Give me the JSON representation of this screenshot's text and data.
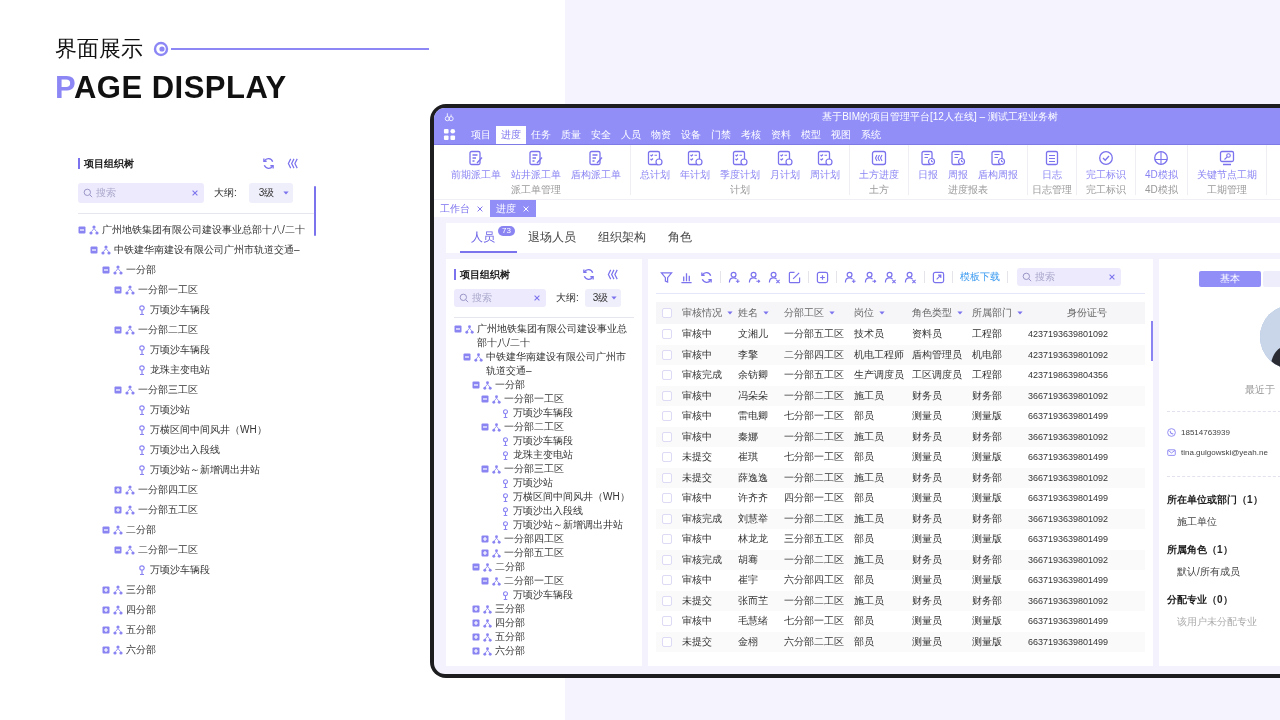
{
  "showcase": {
    "title": "界面展示",
    "subtitle": "PAGE DISPLAY",
    "tree_panel": {
      "title": "项目组织树",
      "search": {
        "placeholder": "搜索"
      },
      "outline_label": "大纲:",
      "outline_value": "3级",
      "tree": [
        {
          "label": "广州地铁集团有限公司建设事业总部十八/二十",
          "kind": "org",
          "expanded": true,
          "children": [
            {
              "label": "中铁建华南建设有限公司广州市轨道交通–",
              "kind": "org",
              "expanded": true,
              "children": [
                {
                  "label": "一分部",
                  "kind": "org",
                  "expanded": true,
                  "children": [
                    {
                      "label": "一分部一工区",
                      "kind": "org",
                      "expanded": true,
                      "children": [
                        {
                          "label": "万顷沙车辆段",
                          "kind": "site"
                        }
                      ]
                    },
                    {
                      "label": "一分部二工区",
                      "kind": "org",
                      "expanded": true,
                      "children": [
                        {
                          "label": "万顷沙车辆段",
                          "kind": "site"
                        },
                        {
                          "label": "龙珠主变电站",
                          "kind": "site"
                        }
                      ]
                    },
                    {
                      "label": "一分部三工区",
                      "kind": "org",
                      "expanded": true,
                      "children": [
                        {
                          "label": "万顷沙站",
                          "kind": "site"
                        },
                        {
                          "label": "万横区间中间风井（WH）",
                          "kind": "site"
                        },
                        {
                          "label": "万顷沙出入段线",
                          "kind": "site"
                        },
                        {
                          "label": "万顷沙站～新增调出井站",
                          "kind": "site"
                        }
                      ]
                    },
                    {
                      "label": "一分部四工区",
                      "kind": "org",
                      "expanded": false
                    },
                    {
                      "label": "一分部五工区",
                      "kind": "org",
                      "expanded": false
                    }
                  ]
                },
                {
                  "label": "二分部",
                  "kind": "org",
                  "expanded": true,
                  "children": [
                    {
                      "label": "二分部一工区",
                      "kind": "org",
                      "expanded": true,
                      "children": [
                        {
                          "label": "万顷沙车辆段",
                          "kind": "site"
                        }
                      ]
                    }
                  ]
                },
                {
                  "label": "三分部",
                  "kind": "org",
                  "expanded": false
                },
                {
                  "label": "四分部",
                  "kind": "org",
                  "expanded": false
                },
                {
                  "label": "五分部",
                  "kind": "org",
                  "expanded": false
                },
                {
                  "label": "六分部",
                  "kind": "org",
                  "expanded": false
                }
              ]
            }
          ]
        }
      ]
    }
  },
  "app": {
    "window": {
      "title": "基于BIM的项目管理平台[12人在线] – 测试工程业务树"
    },
    "menu": [
      {
        "label": "项目",
        "selected": false
      },
      {
        "label": "进度",
        "selected": true
      },
      {
        "label": "任务",
        "selected": false
      },
      {
        "label": "质量",
        "selected": false
      },
      {
        "label": "安全",
        "selected": false
      },
      {
        "label": "人员",
        "selected": false
      },
      {
        "label": "物资",
        "selected": false
      },
      {
        "label": "设备",
        "selected": false
      },
      {
        "label": "门禁",
        "selected": false
      },
      {
        "label": "考核",
        "selected": false
      },
      {
        "label": "资料",
        "selected": false
      },
      {
        "label": "模型",
        "selected": false
      },
      {
        "label": "视图",
        "selected": false
      },
      {
        "label": "系统",
        "selected": false
      }
    ],
    "ribbon": [
      {
        "label": "派工单管理",
        "items": [
          "前期派工单",
          "站井派工单",
          "盾构派工单"
        ]
      },
      {
        "label": "计划",
        "items": [
          "总计划",
          "年计划",
          "季度计划",
          "月计划",
          "周计划"
        ]
      },
      {
        "label": "土方",
        "items": [
          "土方进度"
        ]
      },
      {
        "label": "进度报表",
        "items": [
          "日报",
          "周报",
          "盾构周报"
        ]
      },
      {
        "label": "日志管理",
        "items": [
          "日志"
        ]
      },
      {
        "label": "完工标识",
        "items": [
          "完工标识"
        ]
      },
      {
        "label": "4D模拟",
        "items": [
          "4D模拟"
        ]
      },
      {
        "label": "工期管理",
        "items": [
          "关键节点工期"
        ]
      }
    ],
    "open_tabs": [
      {
        "label": "工作台",
        "selected": false
      },
      {
        "label": "进度",
        "selected": true
      }
    ],
    "people_tabs": [
      {
        "label": "人员",
        "badge": "73",
        "selected": true
      },
      {
        "label": "退场人员",
        "selected": false
      },
      {
        "label": "组织架构",
        "selected": false
      },
      {
        "label": "角色",
        "selected": false
      }
    ],
    "org_panel": {
      "title": "项目组织树",
      "search": {
        "placeholder": "搜索"
      },
      "outline_label": "大纲:",
      "outline_value": "3级",
      "tree": [
        {
          "label": "广州地铁集团有限公司建设事业总部十八/二十",
          "kind": "org",
          "expanded": true,
          "children": [
            {
              "label": "中铁建华南建设有限公司广州市轨道交通–",
              "kind": "org",
              "expanded": true,
              "children": [
                {
                  "label": "一分部",
                  "kind": "org",
                  "expanded": true,
                  "children": [
                    {
                      "label": "一分部一工区",
                      "kind": "org",
                      "expanded": true,
                      "children": [
                        {
                          "label": "万顷沙车辆段",
                          "kind": "site"
                        }
                      ]
                    },
                    {
                      "label": "一分部二工区",
                      "kind": "org",
                      "expanded": true,
                      "children": [
                        {
                          "label": "万顷沙车辆段",
                          "kind": "site"
                        },
                        {
                          "label": "龙珠主变电站",
                          "kind": "site"
                        }
                      ]
                    },
                    {
                      "label": "一分部三工区",
                      "kind": "org",
                      "expanded": true,
                      "children": [
                        {
                          "label": "万顷沙站",
                          "kind": "site"
                        },
                        {
                          "label": "万横区间中间风井（WH）",
                          "kind": "site"
                        },
                        {
                          "label": "万顷沙出入段线",
                          "kind": "site"
                        },
                        {
                          "label": "万顷沙站～新增调出井站",
                          "kind": "site"
                        }
                      ]
                    },
                    {
                      "label": "一分部四工区",
                      "kind": "org",
                      "expanded": false
                    },
                    {
                      "label": "一分部五工区",
                      "kind": "org",
                      "expanded": false
                    }
                  ]
                },
                {
                  "label": "二分部",
                  "kind": "org",
                  "expanded": true,
                  "children": [
                    {
                      "label": "二分部一工区",
                      "kind": "org",
                      "expanded": true,
                      "children": [
                        {
                          "label": "万顷沙车辆段",
                          "kind": "site"
                        }
                      ]
                    }
                  ]
                },
                {
                  "label": "三分部",
                  "kind": "org",
                  "expanded": false
                },
                {
                  "label": "四分部",
                  "kind": "org",
                  "expanded": false
                },
                {
                  "label": "五分部",
                  "kind": "org",
                  "expanded": false
                },
                {
                  "label": "六分部",
                  "kind": "org",
                  "expanded": false
                }
              ]
            }
          ]
        }
      ]
    },
    "toolbar": {
      "template_link": "模板下载",
      "search": {
        "placeholder": "搜索"
      }
    },
    "table": {
      "all_checked": false,
      "columns": [
        {
          "label": "审核情况",
          "sortable": true
        },
        {
          "label": "姓名",
          "sortable": true
        },
        {
          "label": "分部工区",
          "sortable": true
        },
        {
          "label": "岗位",
          "sortable": true
        },
        {
          "label": "角色类型",
          "sortable": true
        },
        {
          "label": "所属部门",
          "sortable": true
        },
        {
          "label": "身份证号",
          "sortable": false
        }
      ],
      "rows": [
        {
          "checked": false,
          "cells": [
            "审核中",
            "文湘儿",
            "一分部五工区",
            "技术员",
            "资料员",
            "工程部",
            "4237193639801092"
          ]
        },
        {
          "checked": false,
          "cells": [
            "审核中",
            "李擎",
            "二分部四工区",
            "机电工程师",
            "盾构管理员",
            "机电部",
            "4237193639801092"
          ]
        },
        {
          "checked": false,
          "cells": [
            "审核完成",
            "余钫卿",
            "一分部五工区",
            "生产调度员",
            "工区调度员",
            "工程部",
            "4237198639804356"
          ]
        },
        {
          "checked": false,
          "cells": [
            "审核中",
            "冯朵朵",
            "一分部二工区",
            "施工员",
            "财务员",
            "财务部",
            "3667193639801092"
          ]
        },
        {
          "checked": false,
          "cells": [
            "审核中",
            "雷电卿",
            "七分部一工区",
            "部员",
            "测量员",
            "测量版",
            "6637193639801499"
          ]
        },
        {
          "checked": false,
          "cells": [
            "审核中",
            "秦娜",
            "一分部二工区",
            "施工员",
            "财务员",
            "财务部",
            "3667193639801092"
          ]
        },
        {
          "checked": false,
          "cells": [
            "未提交",
            "崔琪",
            "七分部一工区",
            "部员",
            "测量员",
            "测量版",
            "6637193639801499"
          ]
        },
        {
          "checked": false,
          "cells": [
            "未提交",
            "薛逸逸",
            "一分部二工区",
            "施工员",
            "财务员",
            "财务部",
            "3667193639801092"
          ]
        },
        {
          "checked": false,
          "cells": [
            "审核中",
            "许齐齐",
            "四分部一工区",
            "部员",
            "测量员",
            "测量版",
            "6637193639801499"
          ]
        },
        {
          "checked": false,
          "cells": [
            "审核完成",
            "刘慧举",
            "一分部二工区",
            "施工员",
            "财务员",
            "财务部",
            "3667193639801092"
          ]
        },
        {
          "checked": false,
          "cells": [
            "审核中",
            "林龙龙",
            "三分部五工区",
            "部员",
            "测量员",
            "测量版",
            "6637193639801499"
          ]
        },
        {
          "checked": false,
          "cells": [
            "审核完成",
            "胡骞",
            "一分部二工区",
            "施工员",
            "财务员",
            "财务部",
            "3667193639801092"
          ]
        },
        {
          "checked": false,
          "cells": [
            "审核中",
            "崔宇",
            "六分部四工区",
            "部员",
            "测量员",
            "测量版",
            "6637193639801499"
          ]
        },
        {
          "checked": false,
          "cells": [
            "未提交",
            "张而芏",
            "一分部二工区",
            "施工员",
            "财务员",
            "财务部",
            "3667193639801092"
          ]
        },
        {
          "checked": false,
          "cells": [
            "审核中",
            "毛慧绪",
            "七分部一工区",
            "部员",
            "测量员",
            "测量版",
            "6637193639801499"
          ]
        },
        {
          "checked": false,
          "cells": [
            "未提交",
            "金栩",
            "六分部二工区",
            "部员",
            "测量员",
            "测量版",
            "6637193639801499"
          ]
        }
      ]
    },
    "detail": {
      "tabs": [
        {
          "label": "基本",
          "selected": true
        },
        {
          "selected": false
        }
      ],
      "last_seen": "最近于",
      "phone": "18514763939",
      "email": "tina.gulgowski@yeah.ne",
      "sections": [
        {
          "title": "所在单位或部门（1）",
          "value": "施工单位",
          "empty": false
        },
        {
          "title": "所属角色（1）",
          "value": "默认/所有成员",
          "empty": false
        },
        {
          "title": "分配专业（0）",
          "value": "该用户未分配专业",
          "empty": true
        }
      ]
    }
  }
}
